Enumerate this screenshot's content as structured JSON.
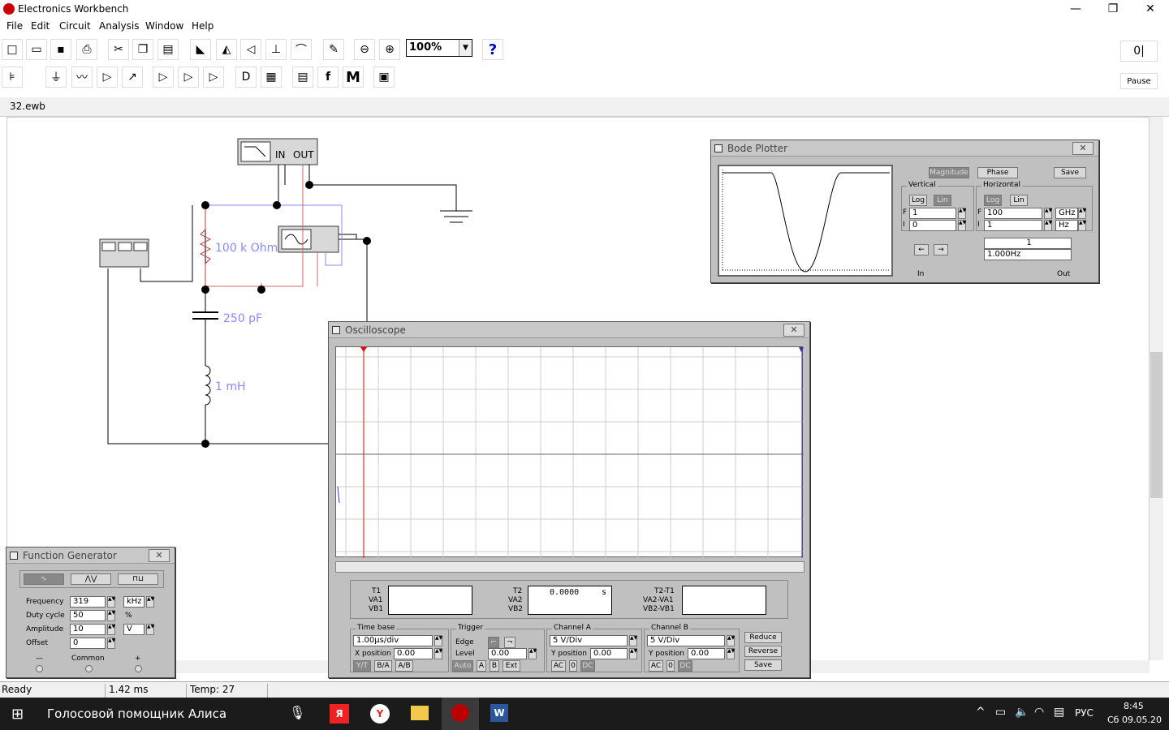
{
  "window": {
    "title": "Electronics Workbench",
    "controls": {
      "minimize": "—",
      "maximize": "❐",
      "close": "✕"
    }
  },
  "menu": [
    "File",
    "Edit",
    "Circuit",
    "Analysis",
    "Window",
    "Help"
  ],
  "toolbar": {
    "zoom": "100%",
    "help": "?",
    "pause": "Pause"
  },
  "document": {
    "title": "32.ewb"
  },
  "circuit": {
    "resistor_label": "100 k Ohm",
    "capacitor_label": "250 pF",
    "inductor_label": "1 mH",
    "bode_in": "IN",
    "bode_out": "OUT",
    "wire_color": "#000000",
    "resistor_color": "#cc3333",
    "label_color": "#8888ff"
  },
  "bode_plotter": {
    "title": "Bode Plotter",
    "magnitude_label": "Magnitude",
    "phase_label": "Phase",
    "save_label": "Save",
    "vertical_label": "Vertical",
    "horizontal_label": "Horizontal",
    "log_label": "Log",
    "lin_label": "Lin",
    "f_label": "F",
    "i_label": "I",
    "vertical_f": "1",
    "vertical_i": "0",
    "horizontal_f": "100",
    "horizontal_f_unit": "GHz",
    "horizontal_i": "1",
    "horizontal_i_unit": "Hz",
    "readout_value": "1",
    "readout_freq": "1.000Hz",
    "in_label": "In",
    "out_label": "Out"
  },
  "oscilloscope": {
    "title": "Oscilloscope",
    "t1": "T1",
    "va1": "VA1",
    "vb1": "VB1",
    "t2": "T2",
    "va2": "VA2",
    "vb2": "VB2",
    "t2t1": "T2-T1",
    "va2va1": "VA2-VA1",
    "vb2vb1": "VB2-VB1",
    "t2_value": "0.0000",
    "t2_unit": "s",
    "timebase_label": "Time base",
    "timebase_value": "1.00µs/div",
    "x_position_label": "X position",
    "x_position_value": "0.00",
    "yt_label": "Y/T",
    "ba_label": "B/A",
    "ab_label": "A/B",
    "trigger_label": "Trigger",
    "edge_label": "Edge",
    "level_label": "Level",
    "level_value": "0.00",
    "auto_label": "Auto",
    "a_label": "A",
    "b_label": "B",
    "ext_label": "Ext",
    "channel_a_label": "Channel A",
    "channel_a_scale": "5  V/Div",
    "channel_a_ypos_label": "Y position",
    "channel_a_ypos": "0.00",
    "channel_b_label": "Channel B",
    "channel_b_scale": "5  V/Div",
    "channel_b_ypos_label": "Y position",
    "channel_b_ypos": "0.00",
    "ac_label": "AC",
    "zero_label": "0",
    "dc_label": "DC",
    "reduce_label": "Reduce",
    "reverse_label": "Reverse",
    "save_label": "Save",
    "cursor1": "1",
    "cursor2": "2"
  },
  "function_generator": {
    "title": "Function Generator",
    "frequency_label": "Frequency",
    "frequency_value": "319",
    "frequency_unit": "kHz",
    "duty_label": "Duty cycle",
    "duty_value": "50",
    "duty_unit": "%",
    "amplitude_label": "Amplitude",
    "amplitude_value": "10",
    "amplitude_unit": "V",
    "offset_label": "Offset",
    "offset_value": "0",
    "minus_label": "—",
    "common_label": "Common",
    "plus_label": "+"
  },
  "status": {
    "ready": "Ready",
    "time": "1.42 ms",
    "temp": "Temp:  27"
  },
  "taskbar": {
    "assistant": "Голосовой помощник Алиса",
    "lang": "РУС",
    "clock_time": "8:45",
    "clock_date": "Сб 09.05.20"
  }
}
